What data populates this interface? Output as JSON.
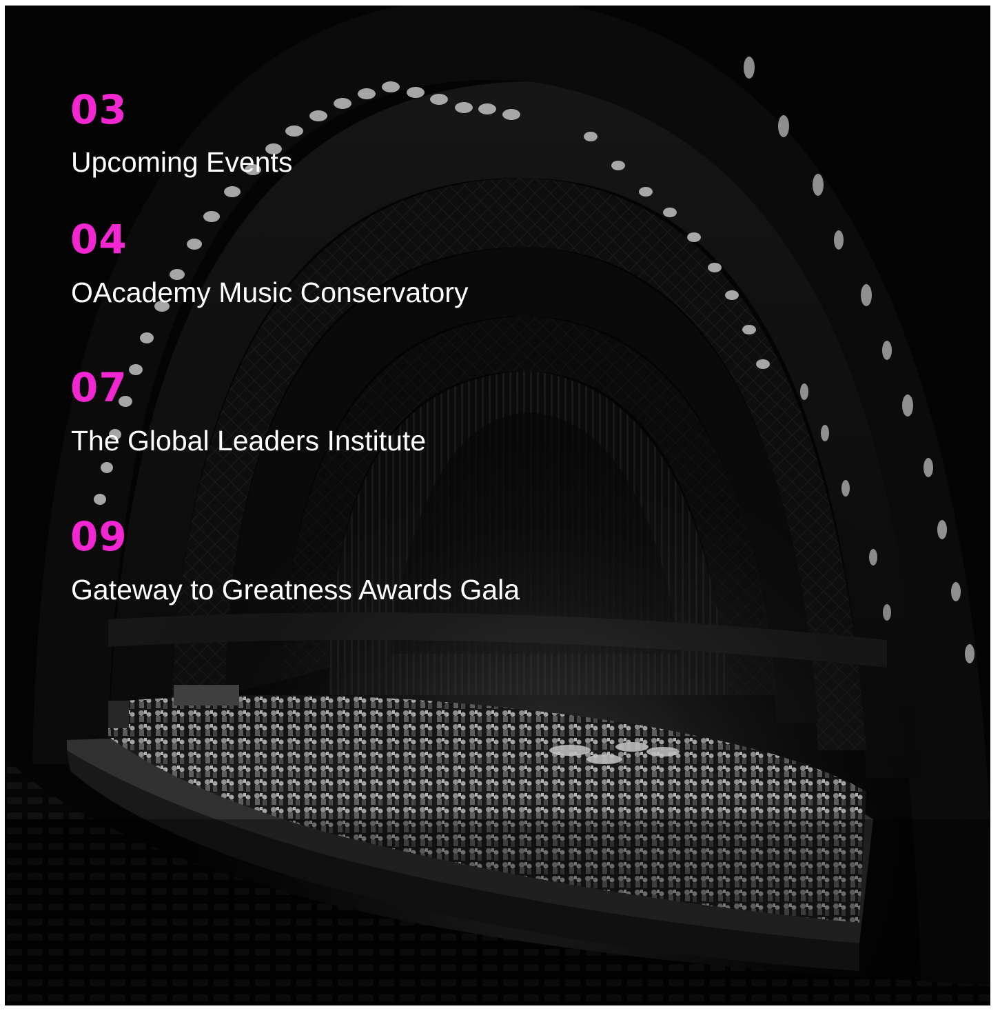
{
  "theme": {
    "accent": "#f227d1",
    "text": "#ffffff",
    "background": "#050505"
  },
  "background_image": {
    "icon": "concert-hall-orchestra-photo"
  },
  "agenda": {
    "items": [
      {
        "number": "03",
        "title": "Upcoming Events"
      },
      {
        "number": "04",
        "title": "OAcademy Music Conservatory"
      },
      {
        "number": "07",
        "title": "The Global Leaders Institute"
      },
      {
        "number": "09",
        "title": "Gateway to Greatness Awards Gala"
      }
    ]
  }
}
